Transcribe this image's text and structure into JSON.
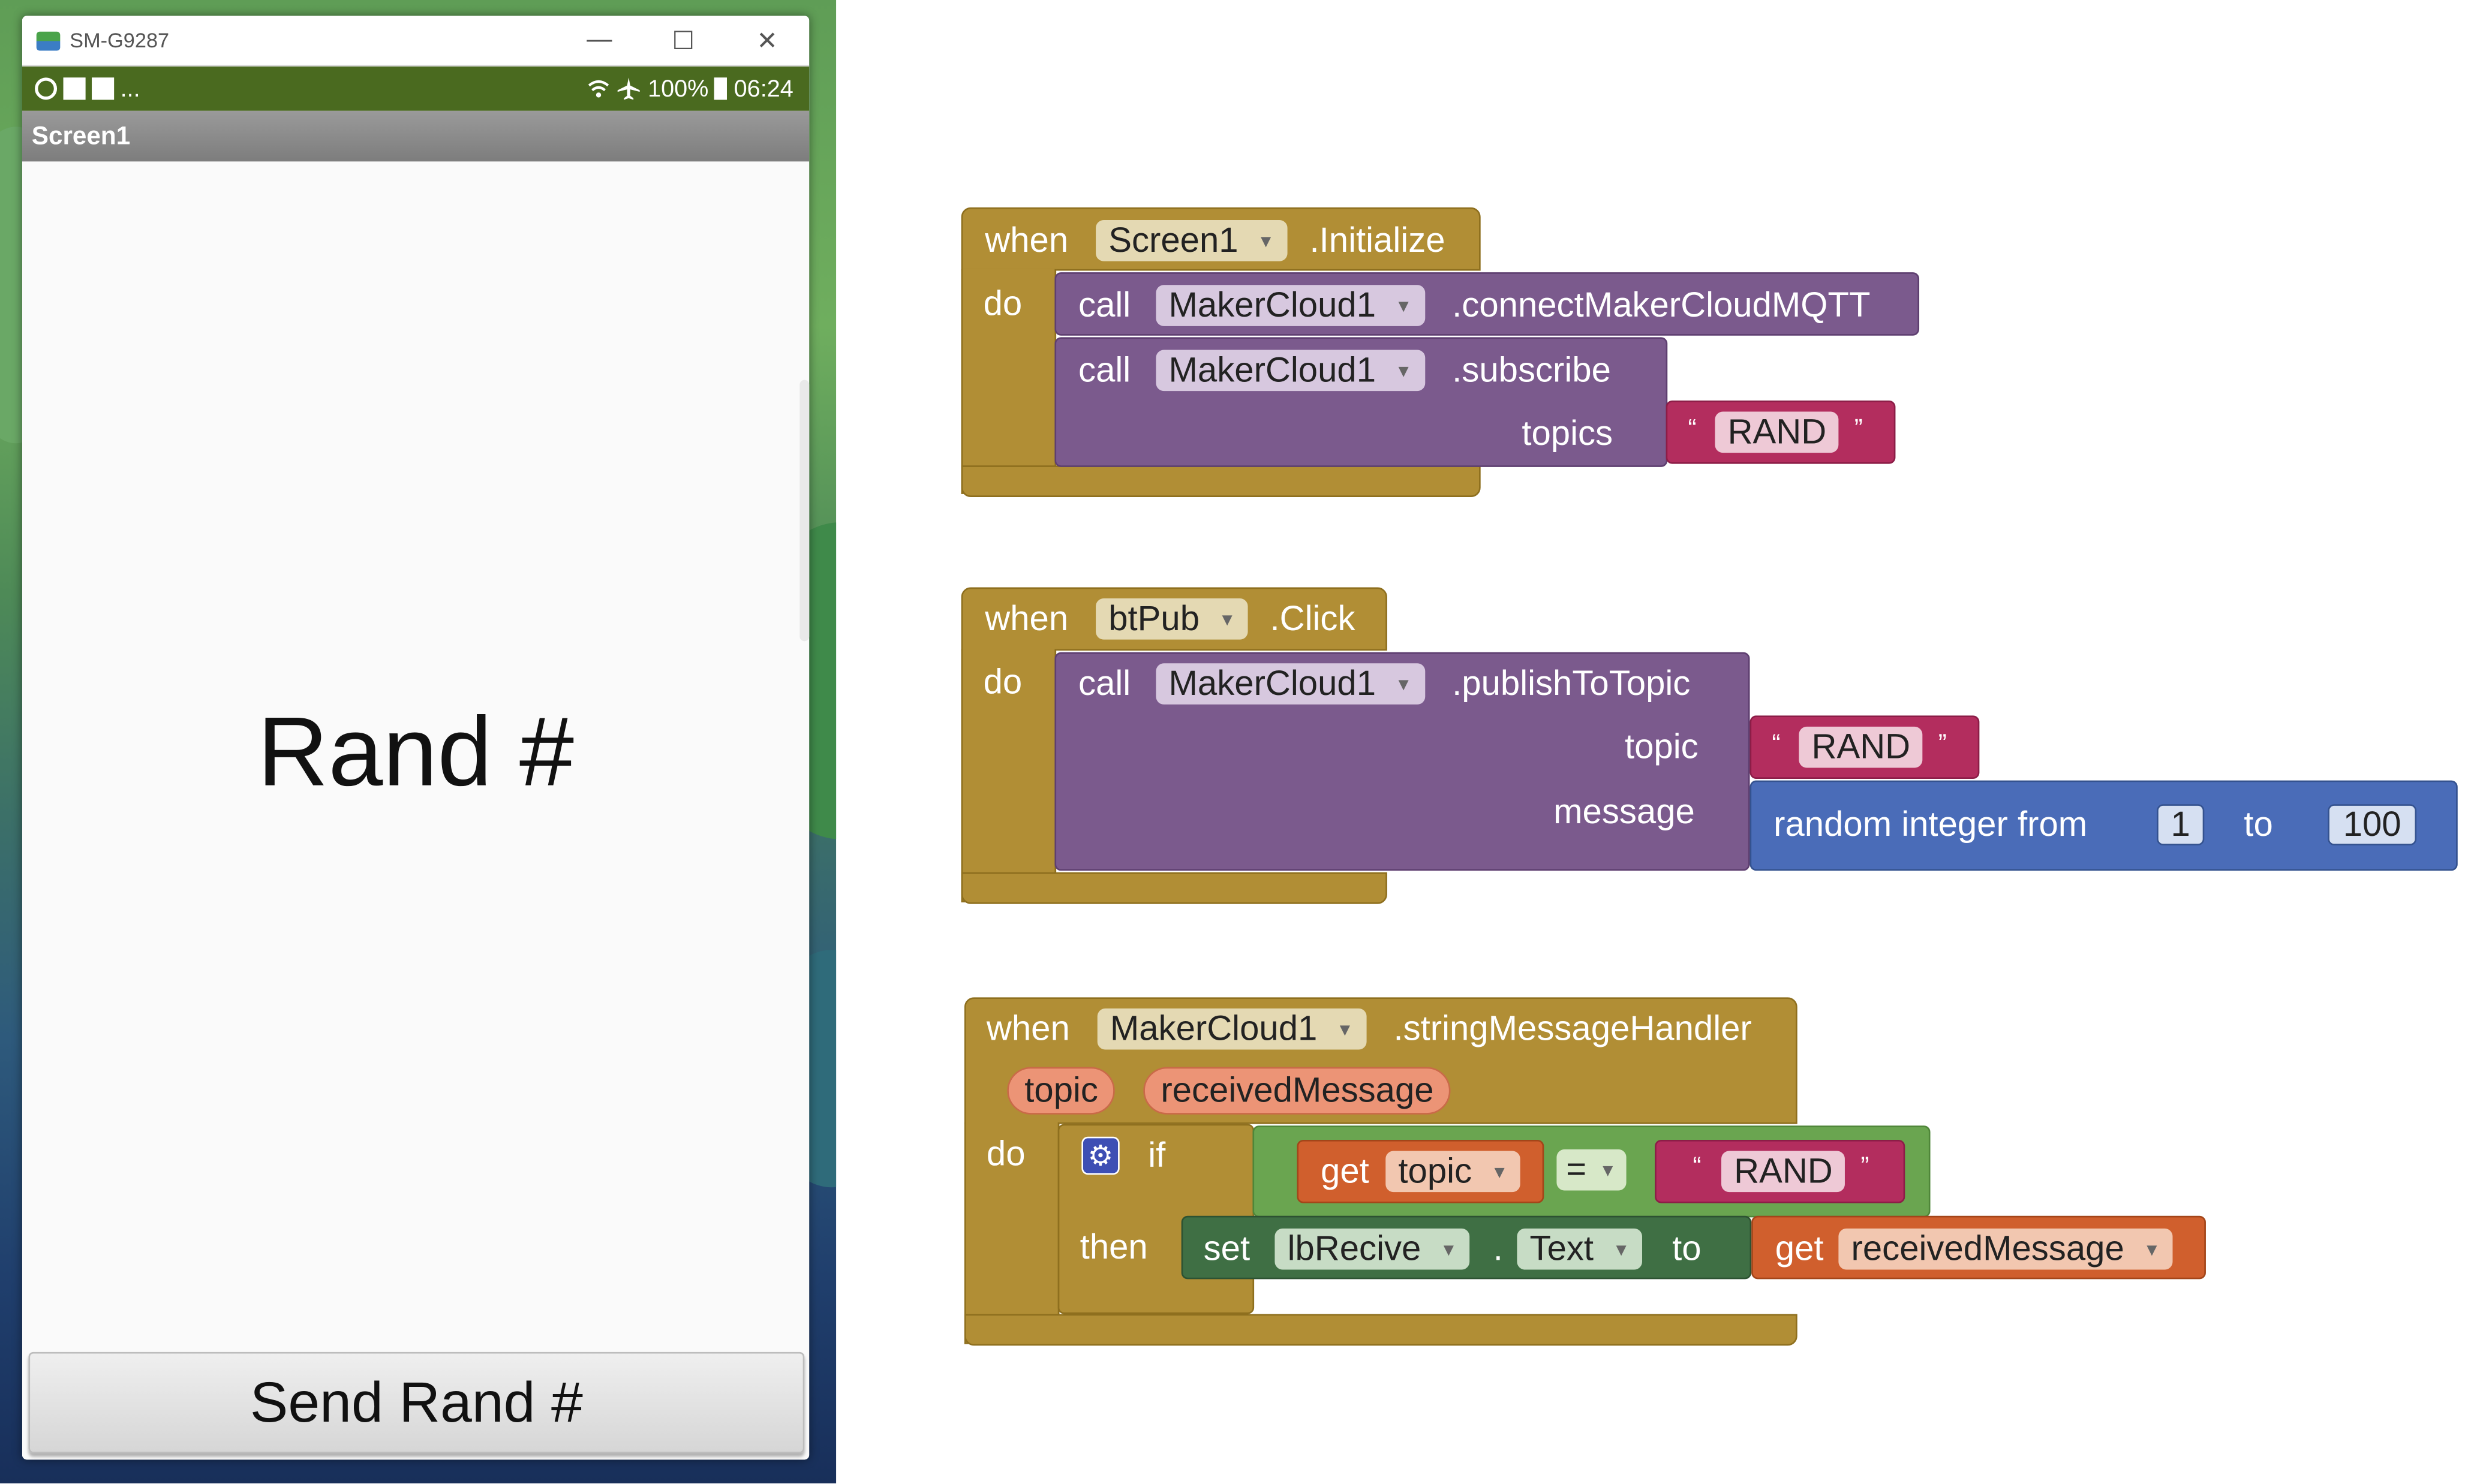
{
  "window": {
    "title": "SM-G9287",
    "minimize_glyph": "—",
    "maximize_glyph": "☐",
    "close_glyph": "✕"
  },
  "statusbar": {
    "left_extra": "...",
    "battery": "100%",
    "time": "06:24",
    "wifi_icon": "wifi-icon",
    "airplane_icon": "airplane-icon"
  },
  "app": {
    "screen_title": "Screen1",
    "label_text": "Rand #",
    "button_text": "Send Rand #"
  },
  "colors": {
    "event": "#b18e35",
    "procedure": "#7b5a8d",
    "text": "#b32d5e",
    "math": "#4a6cb8",
    "variable": "#d05f2d",
    "logic": "#6aa550",
    "component_set": "#3f6f44",
    "status_bar": "#4a6a1f"
  },
  "blocks": {
    "init": {
      "when": "when",
      "component": "Screen1",
      "event": ".Initialize",
      "do": "do",
      "call1": {
        "call": "call",
        "component": "MakerCloud1",
        "method": ".connectMakerCloudMQTT"
      },
      "call2": {
        "call": "call",
        "component": "MakerCloud1",
        "method": ".subscribe",
        "param": "topics",
        "text": "RAND"
      }
    },
    "click": {
      "when": "when",
      "component": "btPub",
      "event": ".Click",
      "do": "do",
      "call": "call",
      "call_component": "MakerCloud1",
      "method": ".publishToTopic",
      "param_topic": "topic",
      "topic_text": "RAND",
      "param_message": "message",
      "random": {
        "label": "random integer from",
        "from": "1",
        "to_label": "to",
        "to": "100"
      }
    },
    "handler": {
      "when": "when",
      "component": "MakerCloud1",
      "event": ".stringMessageHandler",
      "params": [
        "topic",
        "receivedMessage"
      ],
      "do": "do",
      "if": "if",
      "then": "then",
      "get": "get",
      "get_var": "topic",
      "op": "=",
      "compare_text": "RAND",
      "set": "set",
      "set_component": "lbRecive",
      "dot": ".",
      "property": "Text",
      "to": "to",
      "get2": "get",
      "get2_var": "receivedMessage"
    },
    "quote_open": "“",
    "quote_close": "”"
  }
}
